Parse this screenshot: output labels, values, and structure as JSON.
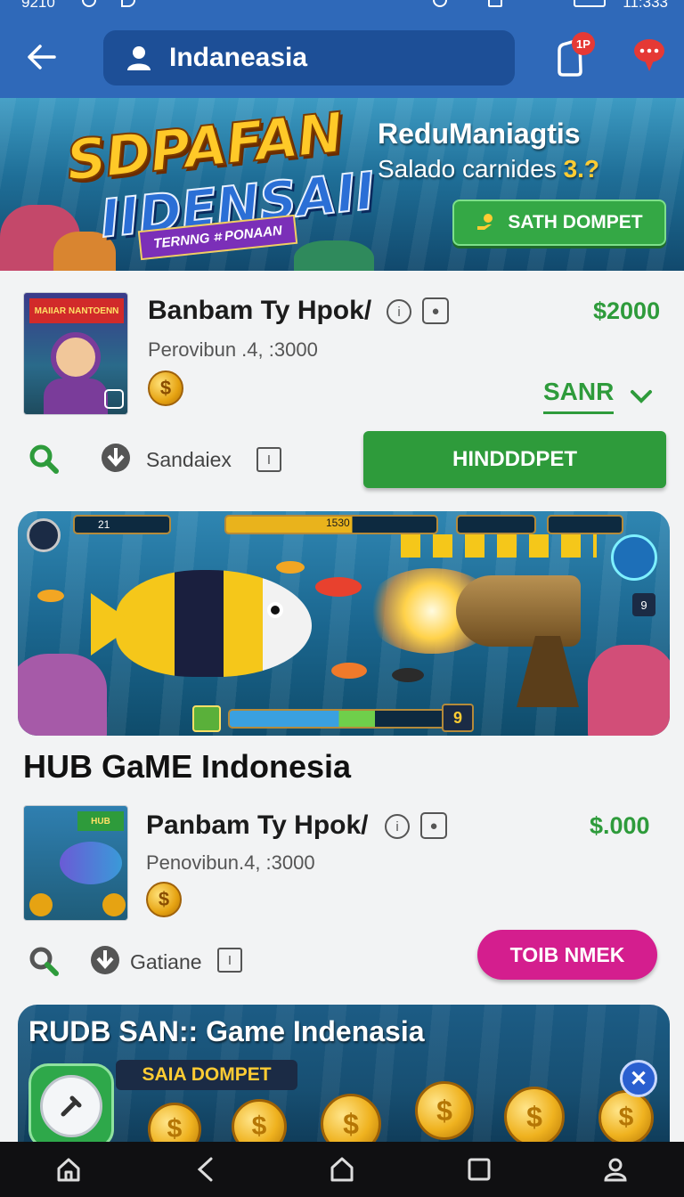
{
  "status_bar": {
    "time_left": "9210",
    "time_right": "11:333"
  },
  "app_bar": {
    "search_text": "Indaneasia",
    "notification_count": "1P"
  },
  "hero": {
    "logo_line1": "SDPAFAN",
    "logo_line2": "IIDENSAII",
    "ribbon": "TERNNG ⌗ PONAAN",
    "title": "ReduManiagtis",
    "subtitle_prefix": "Salado carnides ",
    "subtitle_value": "3.?",
    "button_label": "SATH DOMPET"
  },
  "product_1": {
    "thumb_label": "MAIIAR NANTOENN",
    "title": "Banbam Ty Hpok/",
    "subtitle": "Perovibun .4, :3000",
    "price": "$2000",
    "sort_label": "SANR",
    "action_label": "Sandaiex",
    "cta_label": "HINDDDPET",
    "coin_symbol": "$"
  },
  "game_hud": {
    "top_counter": "1530",
    "top_left": "21",
    "score_right": "9",
    "bottom_badge": "9"
  },
  "section_heading": "HUB GaME Indonesia",
  "product_2": {
    "thumb_label": "HUB",
    "title": "Panbam Ty Hpok/",
    "subtitle": "Penovibun.4, :3000",
    "price": "$.000",
    "action_label": "Gatiane",
    "cta_label": "TOIB NMEK",
    "coin_symbol": "$"
  },
  "promo": {
    "title": "RUDB SAN:: Game Indenasia",
    "pill_label": "SAIA DOMPET",
    "coin_symbol": "$"
  },
  "colors": {
    "header_blue": "#2f69b9",
    "accent_green": "#2e9b3b",
    "accent_pink": "#d41e8e"
  }
}
